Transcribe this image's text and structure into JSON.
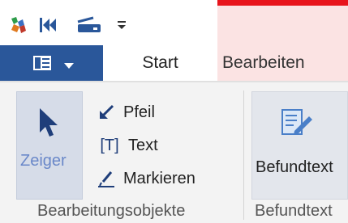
{
  "quick_access": {
    "icons": [
      "puzzle-app-icon",
      "skip-to-start-icon",
      "scanner-icon",
      "customize-toolbar-dropdown-icon"
    ]
  },
  "ribbon_tabs": {
    "file_icon": "document-menu-icon",
    "start": "Start",
    "bearbeiten": "Bearbeiten"
  },
  "groups": {
    "bearbeitungsobjekte": {
      "label": "Bearbeitungsobjekte",
      "zeiger": "Zeiger",
      "pfeil": "Pfeil",
      "text": "Text",
      "text_icon": "[T]",
      "markieren": "Markieren"
    },
    "befundtext": {
      "label": "Befundtext",
      "button": "Befundtext"
    }
  },
  "colors": {
    "accent_blue": "#2a579a",
    "highlight_red": "#e8141c",
    "tab_tint": "#fbe3e3",
    "zeiger_text": "#6a88c9"
  }
}
